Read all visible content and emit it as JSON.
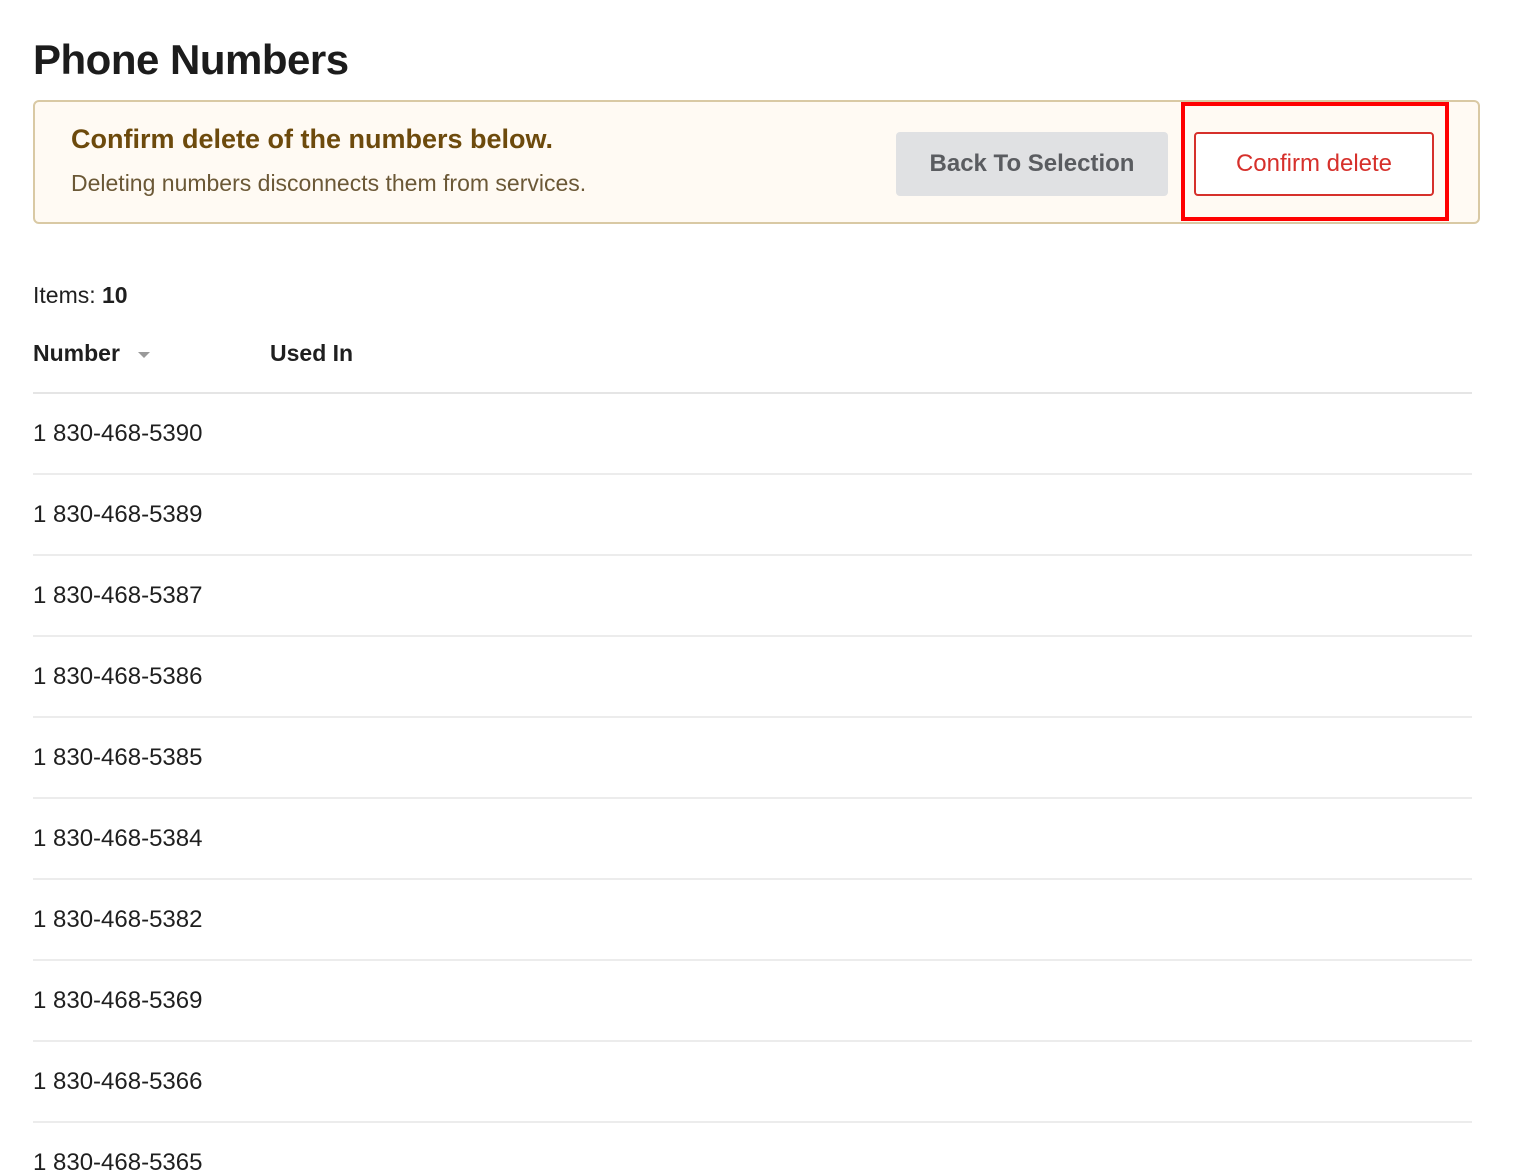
{
  "page": {
    "title": "Phone Numbers"
  },
  "banner": {
    "title": "Confirm delete of the numbers below.",
    "message": "Deleting numbers disconnects them from services.",
    "back_label": "Back To Selection",
    "confirm_label": "Confirm delete"
  },
  "items": {
    "label": "Items:",
    "count": "10"
  },
  "table": {
    "columns": {
      "number": "Number",
      "used_in": "Used In"
    },
    "rows": [
      {
        "number": "1 830-468-5390",
        "used_in": ""
      },
      {
        "number": "1 830-468-5389",
        "used_in": ""
      },
      {
        "number": "1 830-468-5387",
        "used_in": ""
      },
      {
        "number": "1 830-468-5386",
        "used_in": ""
      },
      {
        "number": "1 830-468-5385",
        "used_in": ""
      },
      {
        "number": "1 830-468-5384",
        "used_in": ""
      },
      {
        "number": "1 830-468-5382",
        "used_in": ""
      },
      {
        "number": "1 830-468-5369",
        "used_in": ""
      },
      {
        "number": "1 830-468-5366",
        "used_in": ""
      },
      {
        "number": "1 830-468-5365",
        "used_in": ""
      }
    ]
  },
  "colors": {
    "banner_title": "#6d4a0c",
    "confirm_accent": "#d6302b",
    "highlight": "#ff0000"
  },
  "icons": {
    "sort": "sort-down-icon"
  }
}
